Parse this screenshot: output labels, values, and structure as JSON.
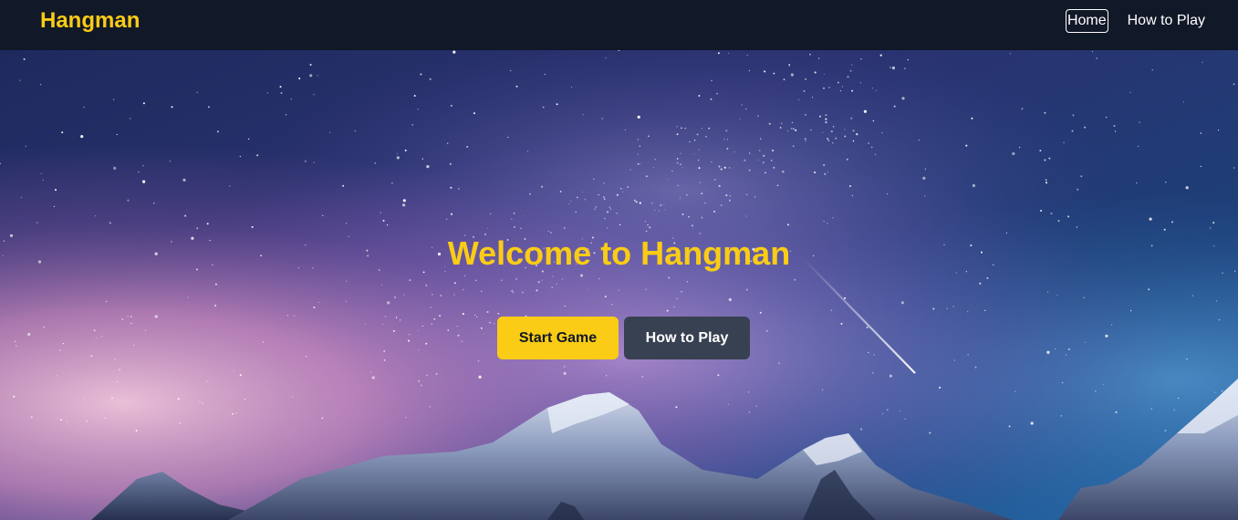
{
  "navbar": {
    "brand": "Hangman",
    "links": [
      {
        "label": "Home",
        "active": true
      },
      {
        "label": "How to Play",
        "active": false
      }
    ]
  },
  "hero": {
    "title": "Welcome to Hangman",
    "buttons": {
      "start_label": "Start Game",
      "howto_label": "How to Play"
    },
    "background": "starry-night-sky-mountains"
  },
  "colors": {
    "accent": "#facc15",
    "navbar_bg": "#111827",
    "secondary_button": "#374151"
  }
}
